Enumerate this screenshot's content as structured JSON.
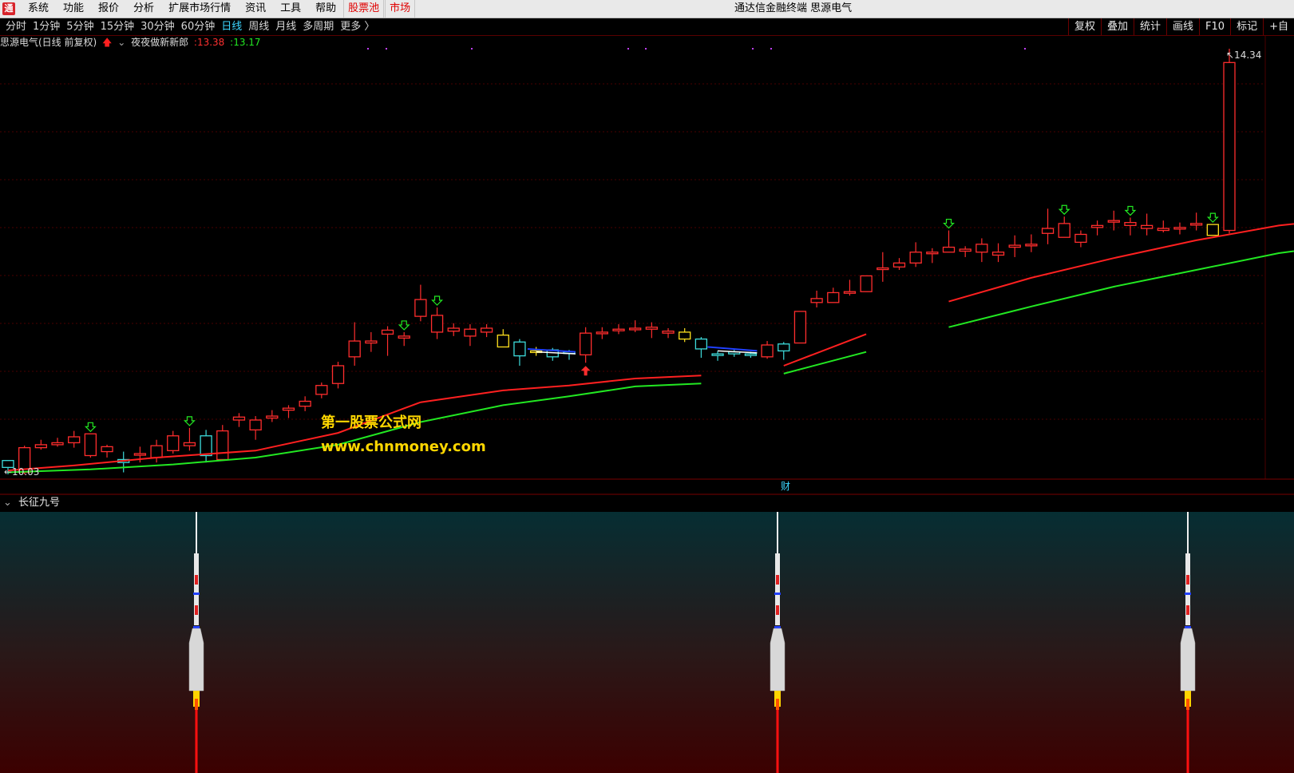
{
  "menubar": {
    "logo": "通",
    "items": [
      "系统",
      "功能",
      "报价",
      "分析",
      "扩展市场行情",
      "资讯",
      "工具",
      "帮助"
    ],
    "highlight": [
      "股票池",
      "市场"
    ],
    "title": "通达信金融终端 思源电气"
  },
  "toolbar": {
    "tabs": [
      "分时",
      "1分钟",
      "5分钟",
      "15分钟",
      "30分钟",
      "60分钟",
      "日线",
      "周线",
      "月线",
      "多周期",
      "更多 〉"
    ],
    "active_tab": "日线",
    "right_buttons": [
      "复权",
      "叠加",
      "统计",
      "画线",
      "F10",
      "标记",
      "+自"
    ]
  },
  "info": {
    "stock": "思源电气(日线 前复权)",
    "indicator": "夜夜做新新郎",
    "value_red": ":13.38",
    "value_green": ":13.17"
  },
  "price_labels": {
    "high": "14.34",
    "low": "10.03"
  },
  "marker_cai": "财",
  "sub_panel": {
    "name": "长征九号"
  },
  "watermark": {
    "line1": "第一股票公式网",
    "line2": "www.chnmoney.com"
  },
  "colors": {
    "up": "#ff2d2d",
    "down": "#3ddcdc",
    "yellow": "#ffe11e",
    "ma_red": "#ff2020",
    "ma_green": "#22e822",
    "blue": "#2040ff",
    "grid": "#4a0000"
  },
  "chart_data": {
    "type": "candlestick",
    "price_range": [
      10.03,
      14.34
    ],
    "candles": [
      {
        "o": 10.1,
        "h": 10.17,
        "l": 10.03,
        "c": 10.17,
        "k": "cyan"
      },
      {
        "o": 10.05,
        "h": 10.32,
        "l": 10.03,
        "c": 10.3,
        "k": "red"
      },
      {
        "o": 10.3,
        "h": 10.38,
        "l": 10.28,
        "c": 10.33,
        "k": "red"
      },
      {
        "o": 10.35,
        "h": 10.4,
        "l": 10.31,
        "c": 10.33,
        "k": "red"
      },
      {
        "o": 10.35,
        "h": 10.47,
        "l": 10.3,
        "c": 10.41,
        "k": "red"
      },
      {
        "o": 10.44,
        "h": 10.44,
        "l": 10.2,
        "c": 10.22,
        "k": "red",
        "arrow": "down"
      },
      {
        "o": 10.26,
        "h": 10.33,
        "l": 10.2,
        "c": 10.31,
        "k": "red"
      },
      {
        "o": 10.18,
        "h": 10.26,
        "l": 10.05,
        "c": 10.15,
        "k": "cyan"
      },
      {
        "o": 10.24,
        "h": 10.31,
        "l": 10.15,
        "c": 10.24,
        "k": "red"
      },
      {
        "o": 10.2,
        "h": 10.38,
        "l": 10.15,
        "c": 10.32,
        "k": "red"
      },
      {
        "o": 10.27,
        "h": 10.47,
        "l": 10.24,
        "c": 10.42,
        "k": "red"
      },
      {
        "o": 10.32,
        "h": 10.5,
        "l": 10.27,
        "c": 10.35,
        "k": "red",
        "arrow": "down"
      },
      {
        "o": 10.42,
        "h": 10.48,
        "l": 10.15,
        "c": 10.22,
        "k": "cyan"
      },
      {
        "o": 10.18,
        "h": 10.53,
        "l": 10.18,
        "c": 10.47,
        "k": "red"
      },
      {
        "o": 10.58,
        "h": 10.65,
        "l": 10.51,
        "c": 10.61,
        "k": "red"
      },
      {
        "o": 10.58,
        "h": 10.62,
        "l": 10.38,
        "c": 10.48,
        "k": "red"
      },
      {
        "o": 10.6,
        "h": 10.68,
        "l": 10.56,
        "c": 10.62,
        "k": "red"
      },
      {
        "o": 10.68,
        "h": 10.73,
        "l": 10.6,
        "c": 10.7,
        "k": "red"
      },
      {
        "o": 10.77,
        "h": 10.82,
        "l": 10.67,
        "c": 10.72,
        "k": "red"
      },
      {
        "o": 10.84,
        "h": 10.96,
        "l": 10.8,
        "c": 10.93,
        "k": "red"
      },
      {
        "o": 10.95,
        "h": 11.17,
        "l": 10.9,
        "c": 11.13,
        "k": "red"
      },
      {
        "o": 11.22,
        "h": 11.57,
        "l": 11.13,
        "c": 11.38,
        "k": "red"
      },
      {
        "o": 11.38,
        "h": 11.47,
        "l": 11.27,
        "c": 11.36,
        "k": "red"
      },
      {
        "o": 11.49,
        "h": 11.53,
        "l": 11.23,
        "c": 11.45,
        "k": "red"
      },
      {
        "o": 11.43,
        "h": 11.47,
        "l": 11.33,
        "c": 11.41,
        "k": "red",
        "arrow": "down"
      },
      {
        "o": 11.8,
        "h": 11.95,
        "l": 11.58,
        "c": 11.63,
        "k": "red"
      },
      {
        "o": 11.64,
        "h": 11.72,
        "l": 11.4,
        "c": 11.47,
        "k": "red",
        "arrow": "down"
      },
      {
        "o": 11.48,
        "h": 11.56,
        "l": 11.43,
        "c": 11.51,
        "k": "red"
      },
      {
        "o": 11.5,
        "h": 11.55,
        "l": 11.33,
        "c": 11.43,
        "k": "red"
      },
      {
        "o": 11.51,
        "h": 11.55,
        "l": 11.42,
        "c": 11.47,
        "k": "red"
      },
      {
        "o": 11.32,
        "h": 11.5,
        "l": 11.32,
        "c": 11.44,
        "k": "yellow"
      },
      {
        "o": 11.37,
        "h": 11.4,
        "l": 11.13,
        "c": 11.23,
        "k": "cyan"
      },
      {
        "o": 11.28,
        "h": 11.32,
        "l": 11.23,
        "c": 11.27,
        "k": "yellow"
      },
      {
        "o": 11.29,
        "h": 11.31,
        "l": 11.18,
        "c": 11.22,
        "k": "cyan"
      },
      {
        "o": 11.27,
        "h": 11.29,
        "l": 11.19,
        "c": 11.26,
        "k": "cyan"
      },
      {
        "o": 11.24,
        "h": 11.52,
        "l": 11.16,
        "c": 11.46,
        "k": "red",
        "arrow": "up"
      },
      {
        "o": 11.47,
        "h": 11.52,
        "l": 11.4,
        "c": 11.46,
        "k": "red"
      },
      {
        "o": 11.5,
        "h": 11.55,
        "l": 11.45,
        "c": 11.49,
        "k": "red"
      },
      {
        "o": 11.51,
        "h": 11.59,
        "l": 11.47,
        "c": 11.51,
        "k": "red"
      },
      {
        "o": 11.52,
        "h": 11.57,
        "l": 11.41,
        "c": 11.5,
        "k": "red"
      },
      {
        "o": 11.48,
        "h": 11.51,
        "l": 11.41,
        "c": 11.46,
        "k": "red"
      },
      {
        "o": 11.4,
        "h": 11.51,
        "l": 11.37,
        "c": 11.47,
        "k": "yellow"
      },
      {
        "o": 11.4,
        "h": 11.42,
        "l": 11.21,
        "c": 11.3,
        "k": "cyan"
      },
      {
        "o": 11.25,
        "h": 11.28,
        "l": 11.18,
        "c": 11.25,
        "k": "cyan"
      },
      {
        "o": 11.27,
        "h": 11.29,
        "l": 11.22,
        "c": 11.25,
        "k": "cyan"
      },
      {
        "o": 11.25,
        "h": 11.27,
        "l": 11.21,
        "c": 11.25,
        "k": "cyan"
      },
      {
        "o": 11.22,
        "h": 11.38,
        "l": 11.2,
        "c": 11.34,
        "k": "red"
      },
      {
        "o": 11.35,
        "h": 11.37,
        "l": 11.19,
        "c": 11.28,
        "k": "cyan"
      },
      {
        "o": 11.36,
        "h": 11.68,
        "l": 11.36,
        "c": 11.68,
        "k": "red"
      },
      {
        "o": 11.77,
        "h": 11.89,
        "l": 11.72,
        "c": 11.81,
        "k": "red"
      },
      {
        "o": 11.77,
        "h": 11.92,
        "l": 11.77,
        "c": 11.87,
        "k": "red"
      },
      {
        "o": 11.88,
        "h": 12.0,
        "l": 11.84,
        "c": 11.88,
        "k": "red"
      },
      {
        "o": 11.88,
        "h": 12.02,
        "l": 11.89,
        "c": 12.04,
        "k": "red"
      },
      {
        "o": 12.12,
        "h": 12.28,
        "l": 11.98,
        "c": 12.12,
        "k": "red"
      },
      {
        "o": 12.13,
        "h": 12.22,
        "l": 12.1,
        "c": 12.17,
        "k": "red"
      },
      {
        "o": 12.17,
        "h": 12.38,
        "l": 12.13,
        "c": 12.28,
        "k": "red"
      },
      {
        "o": 12.28,
        "h": 12.32,
        "l": 12.17,
        "c": 12.28,
        "k": "red"
      },
      {
        "o": 12.28,
        "h": 12.5,
        "l": 12.28,
        "c": 12.33,
        "k": "red",
        "arrow": "down"
      },
      {
        "o": 12.31,
        "h": 12.34,
        "l": 12.23,
        "c": 12.29,
        "k": "red"
      },
      {
        "o": 12.28,
        "h": 12.42,
        "l": 12.18,
        "c": 12.36,
        "k": "red"
      },
      {
        "o": 12.25,
        "h": 12.37,
        "l": 12.18,
        "c": 12.28,
        "k": "red"
      },
      {
        "o": 12.33,
        "h": 12.45,
        "l": 12.23,
        "c": 12.35,
        "k": "red"
      },
      {
        "o": 12.36,
        "h": 12.46,
        "l": 12.28,
        "c": 12.36,
        "k": "red"
      },
      {
        "o": 12.52,
        "h": 12.72,
        "l": 12.36,
        "c": 12.47,
        "k": "red"
      },
      {
        "o": 12.57,
        "h": 12.64,
        "l": 12.47,
        "c": 12.43,
        "k": "red",
        "arrow": "down"
      },
      {
        "o": 12.38,
        "h": 12.5,
        "l": 12.33,
        "c": 12.46,
        "k": "red"
      },
      {
        "o": 12.53,
        "h": 12.6,
        "l": 12.45,
        "c": 12.55,
        "k": "red"
      },
      {
        "o": 12.6,
        "h": 12.7,
        "l": 12.5,
        "c": 12.6,
        "k": "red"
      },
      {
        "o": 12.58,
        "h": 12.63,
        "l": 12.45,
        "c": 12.55,
        "k": "red",
        "arrow": "down"
      },
      {
        "o": 12.55,
        "h": 12.67,
        "l": 12.45,
        "c": 12.52,
        "k": "red"
      },
      {
        "o": 12.5,
        "h": 12.6,
        "l": 12.48,
        "c": 12.52,
        "k": "red"
      },
      {
        "o": 12.53,
        "h": 12.58,
        "l": 12.46,
        "c": 12.53,
        "k": "red"
      },
      {
        "o": 12.57,
        "h": 12.68,
        "l": 12.5,
        "c": 12.57,
        "k": "red"
      },
      {
        "o": 12.45,
        "h": 12.56,
        "l": 12.45,
        "c": 12.56,
        "k": "yellow",
        "arrow": "down"
      },
      {
        "o": 12.5,
        "h": 14.34,
        "l": 12.47,
        "c": 14.2,
        "k": "red"
      }
    ],
    "ma_red": [
      [
        0,
        10.07
      ],
      [
        4,
        10.12
      ],
      [
        9,
        10.2
      ],
      [
        15,
        10.27
      ],
      [
        20,
        10.45
      ],
      [
        25,
        10.76
      ],
      [
        30,
        10.88
      ],
      [
        34,
        10.93
      ],
      [
        38,
        11.0
      ],
      [
        42,
        11.03
      ],
      [
        47,
        11.13
      ],
      [
        52,
        11.45
      ],
      [
        57,
        11.78
      ],
      [
        62,
        12.02
      ],
      [
        67,
        12.22
      ],
      [
        72,
        12.4
      ],
      [
        77,
        12.55
      ],
      [
        82,
        12.64
      ],
      [
        88,
        12.68
      ]
    ],
    "ma_green": [
      [
        0,
        10.05
      ],
      [
        5,
        10.08
      ],
      [
        10,
        10.13
      ],
      [
        15,
        10.2
      ],
      [
        20,
        10.33
      ],
      [
        25,
        10.56
      ],
      [
        30,
        10.73
      ],
      [
        34,
        10.82
      ],
      [
        38,
        10.92
      ],
      [
        42,
        10.95
      ],
      [
        47,
        11.05
      ],
      [
        52,
        11.27
      ],
      [
        57,
        11.52
      ],
      [
        62,
        11.73
      ],
      [
        67,
        11.93
      ],
      [
        72,
        12.1
      ],
      [
        77,
        12.27
      ],
      [
        82,
        12.38
      ],
      [
        88,
        12.48
      ]
    ],
    "rocket_positions": [
      246,
      974,
      1488
    ]
  }
}
